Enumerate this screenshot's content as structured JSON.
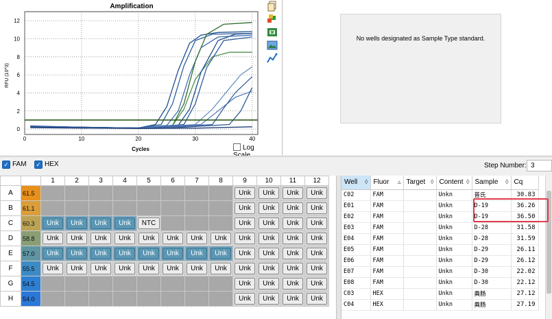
{
  "chart": {
    "title": "Amplification",
    "xlabel": "Cycles",
    "ylabel": "RFU (10^3)",
    "log_scale_label": "Log Scale",
    "log_scale_checked": false
  },
  "chart_data": {
    "type": "line",
    "title": "Amplification",
    "xlabel": "Cycles",
    "ylabel": "RFU (10^3)",
    "xlim": [
      0,
      41
    ],
    "ylim": [
      -0.6,
      13
    ],
    "xticks": [
      0,
      10,
      20,
      30,
      40
    ],
    "yticks": [
      0,
      2,
      4,
      6,
      8,
      10,
      12
    ],
    "grid": true,
    "threshold": 1.0,
    "threshold_color": "#2f5a1e",
    "series": [
      {
        "color": "#1f4e8c",
        "values": [
          [
            1,
            0.35
          ],
          [
            10,
            0.2
          ],
          [
            20,
            0.12
          ],
          [
            23,
            0.5
          ],
          [
            25,
            2.5
          ],
          [
            27,
            6.5
          ],
          [
            29,
            9.5
          ],
          [
            31,
            10.4
          ],
          [
            34,
            10.7
          ],
          [
            40,
            10.8
          ]
        ]
      },
      {
        "color": "#2b5f9e",
        "values": [
          [
            1,
            0.3
          ],
          [
            10,
            0.2
          ],
          [
            20,
            0.12
          ],
          [
            24,
            0.5
          ],
          [
            26,
            2.8
          ],
          [
            28,
            7.0
          ],
          [
            30,
            9.8
          ],
          [
            33,
            10.5
          ],
          [
            40,
            10.6
          ]
        ]
      },
      {
        "color": "#3d6fb0",
        "values": [
          [
            1,
            0.3
          ],
          [
            20,
            0.1
          ],
          [
            25,
            0.4
          ],
          [
            27,
            2.0
          ],
          [
            29,
            6.0
          ],
          [
            31,
            9.0
          ],
          [
            34,
            10.2
          ],
          [
            40,
            10.4
          ]
        ]
      },
      {
        "color": "#2e6b2e",
        "values": [
          [
            1,
            0.25
          ],
          [
            20,
            0.1
          ],
          [
            26,
            0.4
          ],
          [
            28,
            2.8
          ],
          [
            30,
            7.5
          ],
          [
            32,
            10.5
          ],
          [
            35,
            11.6
          ],
          [
            40,
            11.8
          ]
        ]
      },
      {
        "color": "#4f8f4f",
        "values": [
          [
            1,
            0.25
          ],
          [
            20,
            0.1
          ],
          [
            26,
            0.4
          ],
          [
            28,
            2.2
          ],
          [
            30,
            5.5
          ],
          [
            33,
            8.0
          ],
          [
            36,
            8.5
          ],
          [
            40,
            8.5
          ]
        ]
      },
      {
        "color": "#1e4a8a",
        "values": [
          [
            1,
            0.3
          ],
          [
            20,
            0.1
          ],
          [
            27,
            0.4
          ],
          [
            29,
            2.2
          ],
          [
            31,
            6.3
          ],
          [
            34,
            9.8
          ],
          [
            37,
            10.5
          ],
          [
            40,
            10.6
          ]
        ]
      },
      {
        "color": "#2a5aa0",
        "values": [
          [
            1,
            0.3
          ],
          [
            20,
            0.1
          ],
          [
            28,
            0.5
          ],
          [
            30,
            2.8
          ],
          [
            32,
            6.8
          ],
          [
            35,
            9.8
          ],
          [
            40,
            10.2
          ]
        ]
      },
      {
        "color": "#6b8fc6",
        "values": [
          [
            1,
            0.25
          ],
          [
            20,
            0.1
          ],
          [
            30,
            0.5
          ],
          [
            33,
            2.2
          ],
          [
            36,
            4.5
          ],
          [
            38,
            6.0
          ],
          [
            40,
            6.9
          ]
        ]
      },
      {
        "color": "#5a7fbf",
        "values": [
          [
            1,
            0.25
          ],
          [
            20,
            0.1
          ],
          [
            31,
            0.5
          ],
          [
            34,
            2.0
          ],
          [
            37,
            3.5
          ],
          [
            40,
            4.2
          ]
        ]
      },
      {
        "color": "#355f9c",
        "values": [
          [
            1,
            0.25
          ],
          [
            22,
            0.1
          ],
          [
            33,
            0.5
          ],
          [
            35,
            2.3
          ],
          [
            37,
            4.0
          ],
          [
            39,
            5.2
          ],
          [
            40,
            5.8
          ]
        ]
      },
      {
        "color": "#2c5693",
        "values": [
          [
            1,
            0.2
          ],
          [
            25,
            0.1
          ],
          [
            36,
            0.5
          ],
          [
            38,
            2.0
          ],
          [
            40,
            4.6
          ]
        ]
      },
      {
        "color": "#233f78",
        "values": [
          [
            1,
            0.15
          ],
          [
            20,
            0.05
          ],
          [
            30,
            0.1
          ],
          [
            40,
            0.25
          ]
        ]
      }
    ]
  },
  "std_panel": {
    "message": "No wells designated as Sample Type standard."
  },
  "options": {
    "fam_label": "FAM",
    "hex_label": "HEX",
    "step_label": "Step Number:",
    "step_value": "3"
  },
  "plate": {
    "columns": [
      "1",
      "2",
      "3",
      "4",
      "5",
      "6",
      "7",
      "8",
      "9",
      "10",
      "11",
      "12"
    ],
    "rows": [
      {
        "label": "A",
        "temp": "61.5",
        "temp_color": "#e8901c",
        "wells": [
          "",
          "",
          "",
          "",
          "",
          "",
          "",
          "",
          "Unk",
          "Unk",
          "Unk",
          "Unk"
        ]
      },
      {
        "label": "B",
        "temp": "61.1",
        "temp_color": "#d99d3a",
        "wells": [
          "",
          "",
          "",
          "",
          "",
          "",
          "",
          "",
          "Unk",
          "Unk",
          "Unk",
          "Unk"
        ]
      },
      {
        "label": "C",
        "temp": "60.3",
        "temp_color": "#bca353",
        "wells": [
          "Unk*",
          "Unk*",
          "Unk*",
          "Unk*",
          "NTC",
          "",
          "",
          "",
          "Unk",
          "Unk",
          "Unk",
          "Unk"
        ]
      },
      {
        "label": "D",
        "temp": "58.8",
        "temp_color": "#8a9e76",
        "wells": [
          "Unk",
          "Unk",
          "Unk",
          "Unk",
          "Unk",
          "Unk",
          "Unk",
          "Unk",
          "Unk",
          "Unk",
          "Unk",
          "Unk"
        ]
      },
      {
        "label": "E",
        "temp": "57.0",
        "temp_color": "#5f95a3",
        "wells": [
          "Unk*",
          "Unk*",
          "Unk*",
          "Unk*",
          "Unk*",
          "Unk*",
          "Unk*",
          "Unk*",
          "Unk",
          "Unk",
          "Unk",
          "Unk"
        ]
      },
      {
        "label": "F",
        "temp": "55.5",
        "temp_color": "#3d8bc4",
        "wells": [
          "Unk",
          "Unk",
          "Unk",
          "Unk",
          "Unk",
          "Unk",
          "Unk",
          "Unk",
          "Unk",
          "Unk",
          "Unk",
          "Unk"
        ]
      },
      {
        "label": "G",
        "temp": "54.5",
        "temp_color": "#2d7fd2",
        "wells": [
          "",
          "",
          "",
          "",
          "",
          "",
          "",
          "",
          "Unk",
          "Unk",
          "Unk",
          "Unk"
        ]
      },
      {
        "label": "H",
        "temp": "54.0",
        "temp_color": "#2a78d8",
        "wells": [
          "",
          "",
          "",
          "",
          "",
          "",
          "",
          "",
          "Unk",
          "Unk",
          "Unk",
          "Unk"
        ]
      }
    ]
  },
  "results": {
    "headers": [
      "Well",
      "Fluor",
      "Target",
      "Content",
      "Sample",
      "Cq"
    ],
    "rows": [
      [
        "C02",
        "FAM",
        "",
        "Unkn",
        "普氏",
        "30.83"
      ],
      [
        "E01",
        "FAM",
        "",
        "Unkn",
        "D-19",
        "36.26"
      ],
      [
        "E02",
        "FAM",
        "",
        "Unkn",
        "D-19",
        "36.50"
      ],
      [
        "E03",
        "FAM",
        "",
        "Unkn",
        "D-28",
        "31.58"
      ],
      [
        "E04",
        "FAM",
        "",
        "Unkn",
        "D-28",
        "31.59"
      ],
      [
        "E05",
        "FAM",
        "",
        "Unkn",
        "D-29",
        "26.11"
      ],
      [
        "E06",
        "FAM",
        "",
        "Unkn",
        "D-29",
        "26.12"
      ],
      [
        "E07",
        "FAM",
        "",
        "Unkn",
        "D-30",
        "22.02"
      ],
      [
        "E08",
        "FAM",
        "",
        "Unkn",
        "D-30",
        "22.12"
      ],
      [
        "C03",
        "HEX",
        "",
        "Unkn",
        "粪肠",
        "27.12"
      ],
      [
        "C04",
        "HEX",
        "",
        "Unkn",
        "粪肠",
        "27.19"
      ]
    ]
  },
  "icons": [
    "copy-icon",
    "color-palette-icon",
    "export-excel-icon",
    "image-icon",
    "chart-settings-icon"
  ]
}
